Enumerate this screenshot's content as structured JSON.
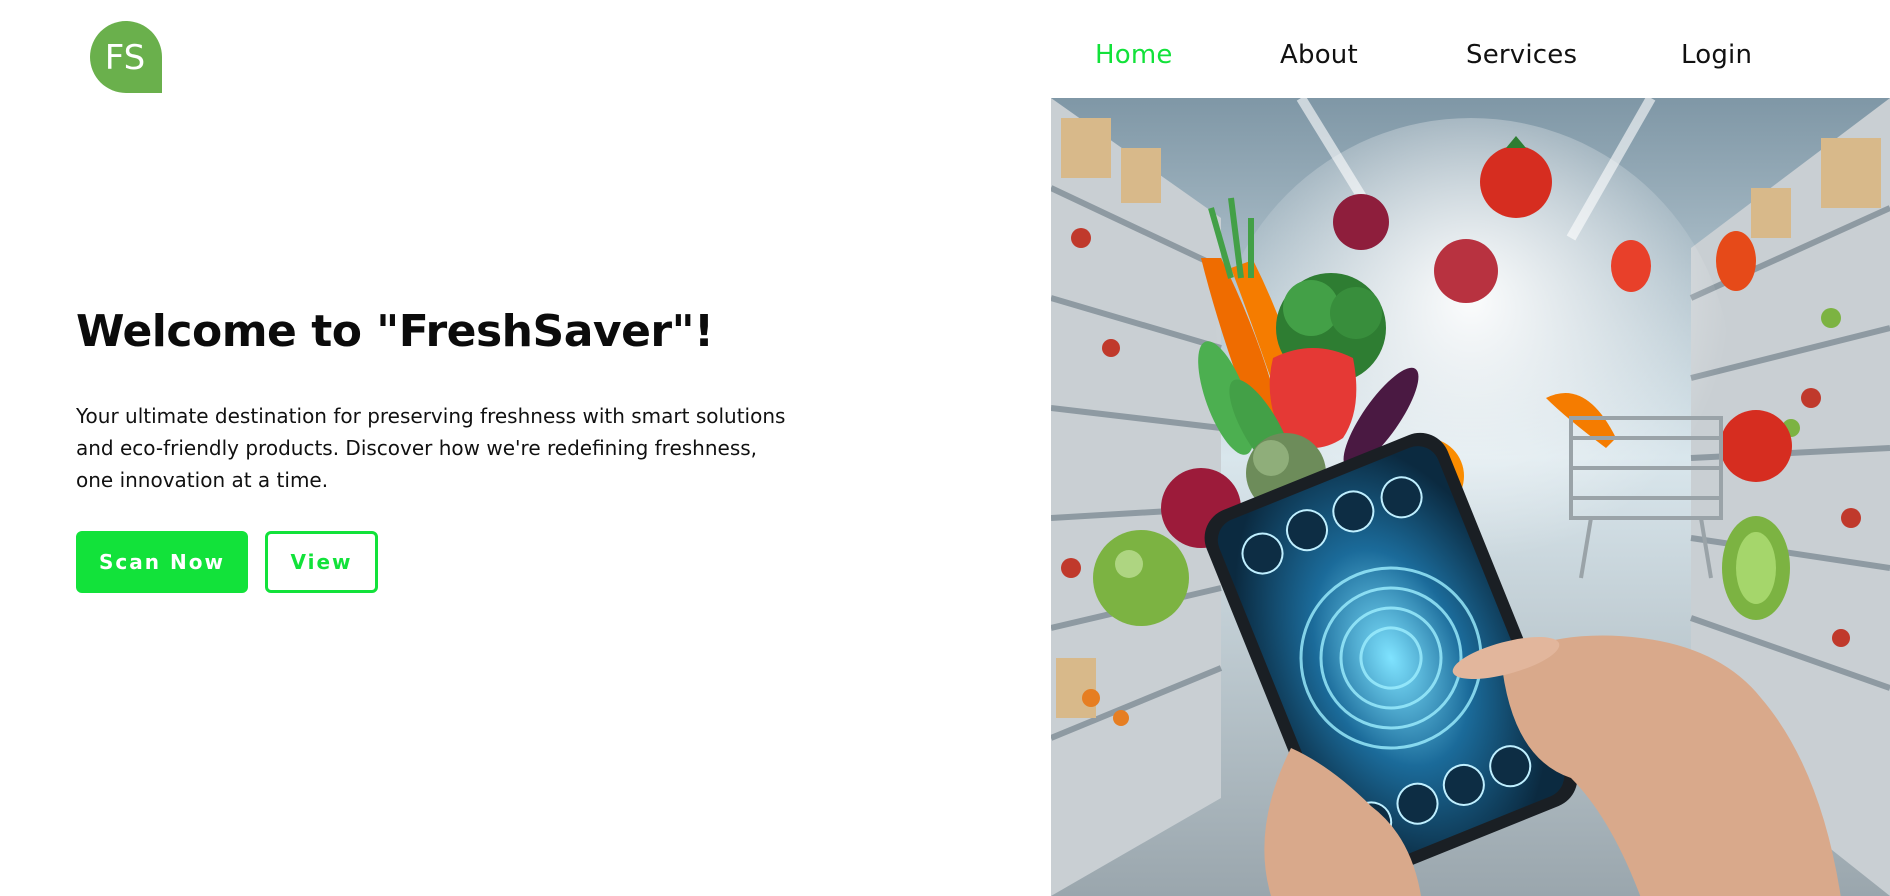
{
  "logo": {
    "text": "FS",
    "color": "#6ab04c"
  },
  "nav": {
    "items": [
      {
        "label": "Home",
        "active": true
      },
      {
        "label": "About",
        "active": false
      },
      {
        "label": "Services",
        "active": false
      },
      {
        "label": "Login",
        "active": false
      }
    ],
    "active_color": "#12e23a"
  },
  "hero": {
    "title": "Welcome to \"FreshSaver\"!",
    "description": "Your ultimate destination for preserving freshness with smart solutions and eco-friendly products. Discover how we're redefining freshness, one innovation at a time.",
    "primary_button": "Scan Now",
    "secondary_button": "View",
    "accent_color": "#12e23a"
  },
  "hero_image": {
    "subject": "hand holding smartphone in supermarket aisle with vegetables flying out"
  }
}
